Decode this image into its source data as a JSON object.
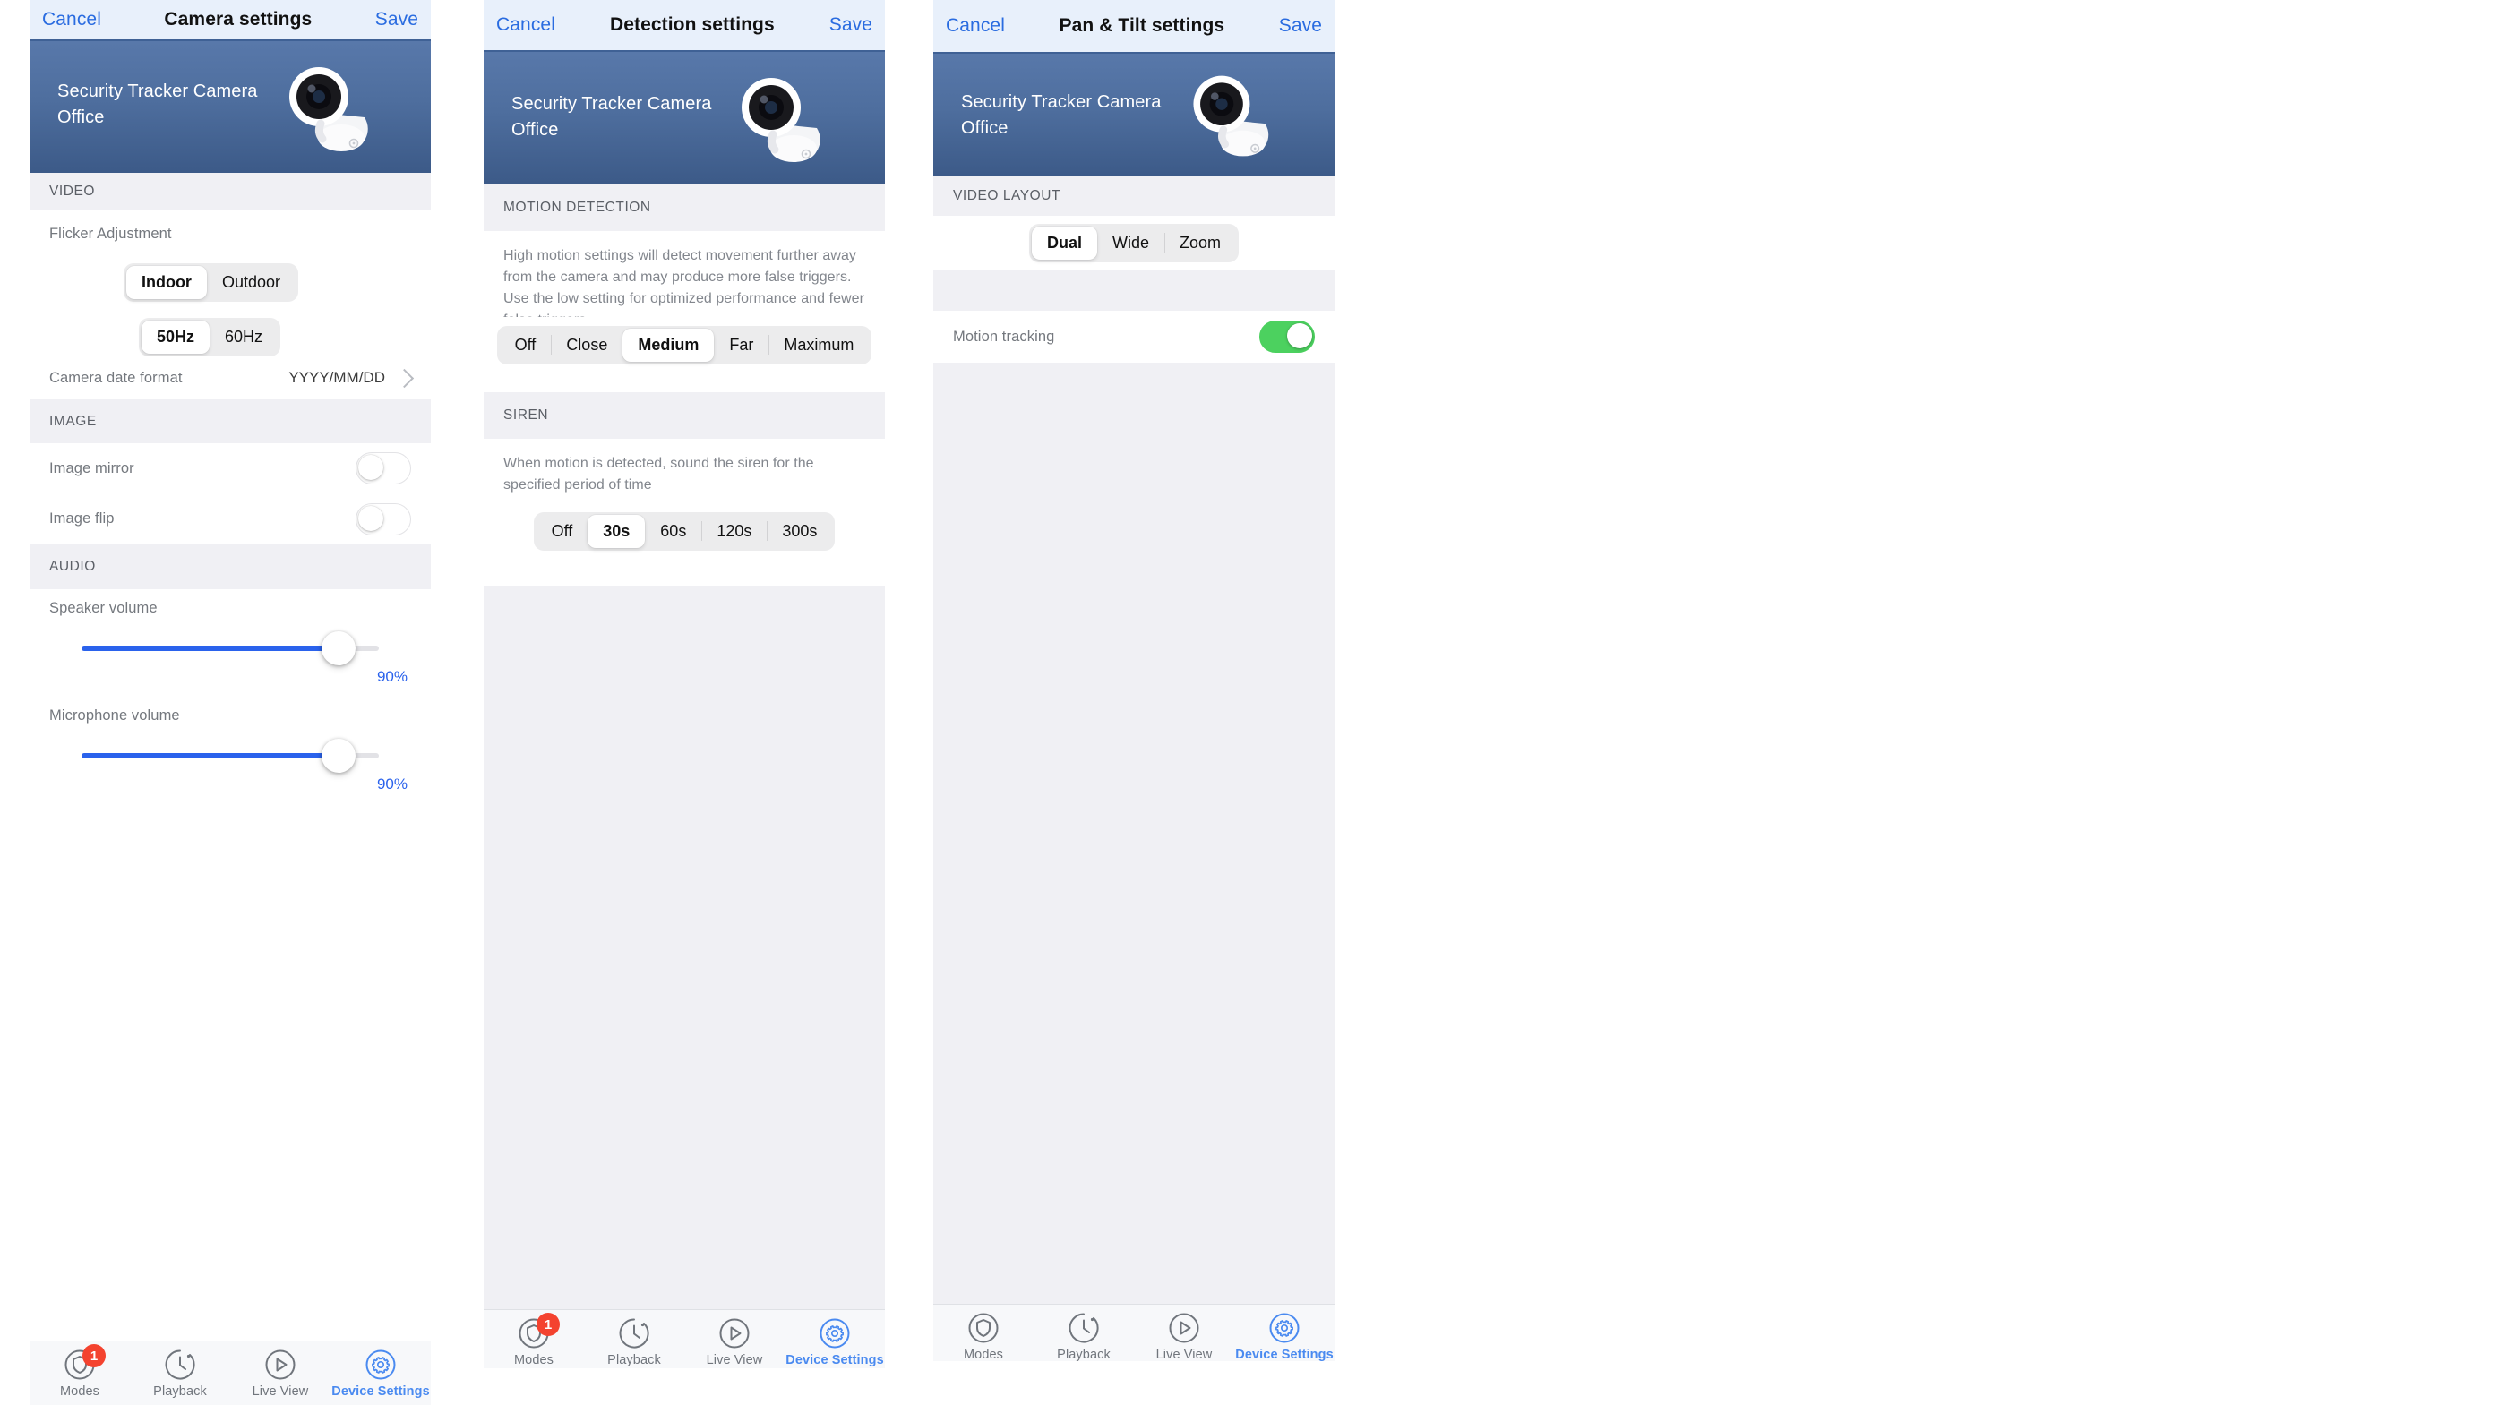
{
  "panels": [
    {
      "nav": {
        "cancel": "Cancel",
        "title": "Camera settings",
        "save": "Save"
      },
      "hero": {
        "device_name": "Security Tracker Camera",
        "room": "Office"
      },
      "sections": {
        "video": "VIDEO",
        "image": "IMAGE",
        "audio": "AUDIO"
      },
      "flicker": {
        "label": "Flicker Adjustment",
        "location_options": [
          "Indoor",
          "Outdoor"
        ],
        "location_selected": "Indoor",
        "frequency_options": [
          "50Hz",
          "60Hz"
        ],
        "frequency_selected": "50Hz"
      },
      "date_format": {
        "label": "Camera date format",
        "value": "YYYY/MM/DD"
      },
      "image_mirror": {
        "label": "Image mirror",
        "on": false
      },
      "image_flip": {
        "label": "Image flip",
        "on": false
      },
      "speaker_volume": {
        "label": "Speaker volume",
        "value": "90%",
        "percent": 90
      },
      "microphone_volume": {
        "label": "Microphone volume",
        "value": "90%",
        "percent": 90
      }
    },
    {
      "nav": {
        "cancel": "Cancel",
        "title": "Detection settings",
        "save": "Save"
      },
      "hero": {
        "device_name": "Security Tracker Camera",
        "room": "Office"
      },
      "sections": {
        "motion": "MOTION DETECTION",
        "siren": "SIREN"
      },
      "motion": {
        "description": "High motion settings will detect movement further away from the camera and may produce more false triggers. Use the low setting for optimized performance and fewer false triggers",
        "options": [
          "Off",
          "Close",
          "Medium",
          "Far",
          "Maximum"
        ],
        "selected": "Medium"
      },
      "siren": {
        "description": "When motion is detected, sound the siren for the specified period of time",
        "options": [
          "Off",
          "30s",
          "60s",
          "120s",
          "300s"
        ],
        "selected": "30s"
      }
    },
    {
      "nav": {
        "cancel": "Cancel",
        "title": "Pan & Tilt settings",
        "save": "Save"
      },
      "hero": {
        "device_name": "Security Tracker Camera",
        "room": "Office"
      },
      "sections": {
        "video_layout": "VIDEO LAYOUT"
      },
      "layout": {
        "options": [
          "Dual",
          "Wide",
          "Zoom"
        ],
        "selected": "Dual"
      },
      "motion_tracking": {
        "label": "Motion tracking",
        "on": true
      }
    }
  ],
  "tabbar": {
    "items": [
      {
        "label": "Modes",
        "icon": "shield-icon",
        "badge": "1",
        "active": false
      },
      {
        "label": "Playback",
        "icon": "clock-icon",
        "badge": "",
        "active": false
      },
      {
        "label": "Live View",
        "icon": "play-icon",
        "badge": "",
        "active": false
      },
      {
        "label": "Device Settings",
        "icon": "gear-icon",
        "badge": "",
        "active": true
      }
    ]
  },
  "colors": {
    "accent_blue": "#2a6ce0",
    "slider_blue": "#2a62ec",
    "toggle_green": "#4cd15f",
    "badge_red": "#f4432f",
    "hero_blue": "#4e6e9e",
    "nav_bg": "#e8f0fb"
  }
}
